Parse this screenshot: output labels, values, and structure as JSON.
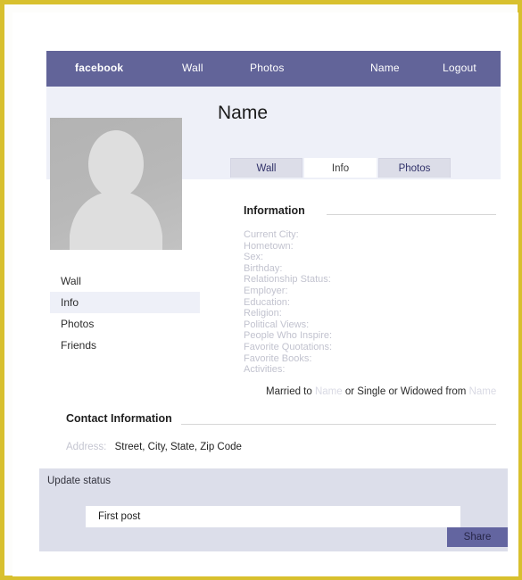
{
  "frame": {
    "border_color": "#d8c02e"
  },
  "topnav": {
    "background": "#626499",
    "brand": "facebook",
    "items": [
      {
        "label": "Wall"
      },
      {
        "label": "Photos"
      },
      {
        "label": "Name"
      },
      {
        "label": "Logout"
      }
    ]
  },
  "profile": {
    "background": "#eef0f8",
    "title": "Name",
    "avatar_icon": "user-silhouette-icon",
    "tabs": [
      {
        "label": "Wall",
        "active": false
      },
      {
        "label": "Info",
        "active": true
      },
      {
        "label": "Photos",
        "active": false
      }
    ]
  },
  "sidebar": {
    "items": [
      {
        "label": "Wall",
        "active": false
      },
      {
        "label": "Info",
        "active": true
      },
      {
        "label": "Photos",
        "active": false
      },
      {
        "label": "Friends",
        "active": false
      }
    ]
  },
  "information": {
    "heading": "Information",
    "fields": [
      "Current City:",
      "Hometown:",
      "Sex:",
      "Birthday:",
      "Relationship Status:",
      "Employer:",
      "Education:",
      "Religion:",
      "Political Views:",
      "People Who Inspire:",
      "Favorite Quotations:",
      "Favorite Books:",
      "Activities:"
    ],
    "marital": {
      "prefix": "Married to",
      "name_1": "Name",
      "middle": "or Single or Widowed from",
      "name_2": "Name"
    }
  },
  "contact": {
    "heading": "Contact Information",
    "address_label": "Address:",
    "address_value": "Street, City, State, Zip Code"
  },
  "update_status": {
    "label": "Update status",
    "background": "#dcdeea",
    "input_value": "First post",
    "share_label": "Share",
    "share_color": "#6365a0"
  },
  "watermark": {
    "text": ""
  }
}
